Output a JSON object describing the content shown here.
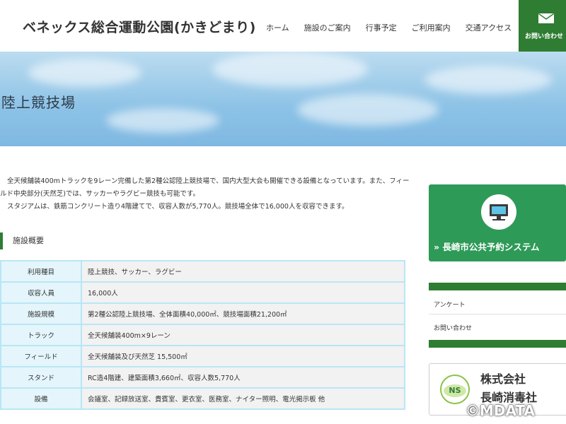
{
  "header": {
    "site_title": "ベネックス総合運動公園(かきどまり)",
    "nav": [
      "ホーム",
      "施設のご案内",
      "行事予定",
      "ご利用案内",
      "交通アクセス"
    ],
    "contact_label": "お問い合わせ"
  },
  "hero": {
    "title": "陸上競技場"
  },
  "intro": {
    "p1": "全天候舗装400mトラックを9レーン完備した第2種公認陸上競技場で、国内大型大会も開催できる設備となっています。また、フィールド中央部分(天然芝)では、サッカーやラグビー競技も可能です。",
    "p2": "スタジアムは、鉄筋コンクリート造り4階建てで、収容人数が5,770人。競技場全体で16,000人を収容できます。"
  },
  "section": {
    "heading": "施設概要"
  },
  "table": {
    "rows": [
      {
        "label": "利用種目",
        "value": "陸上競技、サッカー、ラグビー"
      },
      {
        "label": "収容人員",
        "value": "16,000人"
      },
      {
        "label": "施設規模",
        "value": "第2種公認陸上競技場、全体面積40,000㎡、競技場面積21,200㎡"
      },
      {
        "label": "トラック",
        "value": "全天候舗装400m×9レーン"
      },
      {
        "label": "フィールド",
        "value": "全天候舗装及び天然芝 15,500㎡"
      },
      {
        "label": "スタンド",
        "value": "RC造4階建、建築面積3,660㎡、収容人数5,770人"
      },
      {
        "label": "設備",
        "value": "会議室、記録放送室、貴賓室、更衣室、医務室、ナイター照明、電光掲示板 他"
      }
    ]
  },
  "sidebar": {
    "reserve_label": "» 長崎市公共予約システム",
    "links": [
      "アンケート",
      "お問い合わせ"
    ],
    "sponsor": {
      "name_line1": "株式会社",
      "name_line2": "長崎消毒社",
      "logo_text": "NS"
    }
  },
  "watermark": "©MDATA",
  "colors": {
    "accent": "#2e7d32",
    "banner_green": "#2e9a57",
    "table_border": "#b9e6f5"
  }
}
